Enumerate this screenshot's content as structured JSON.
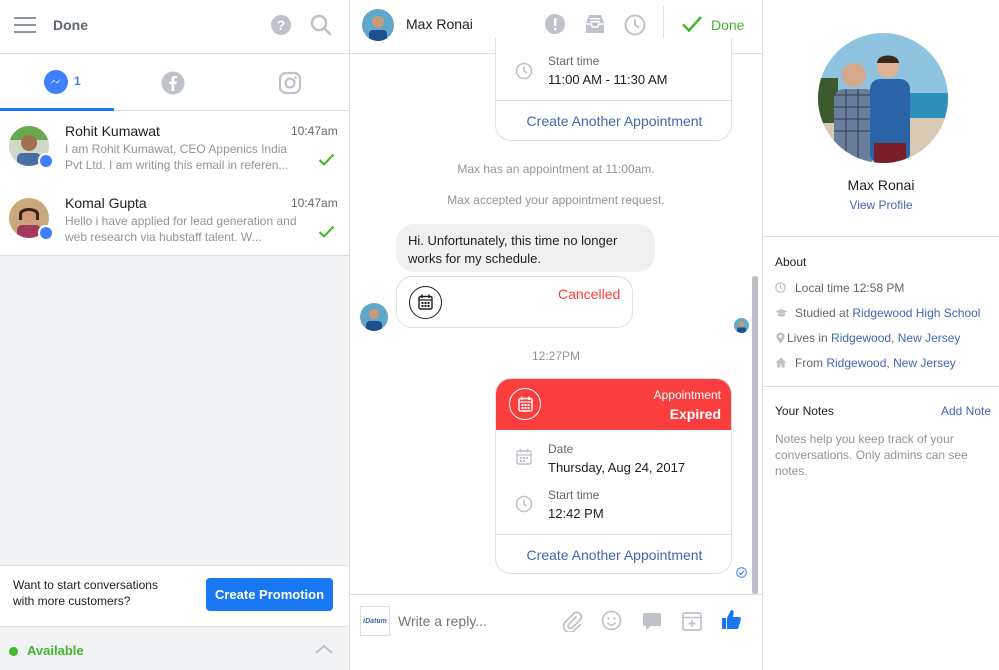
{
  "left": {
    "header": {
      "title": "Done"
    },
    "tabs": {
      "messenger_count": "1"
    },
    "conversations": [
      {
        "name": "Rohit Kumawat",
        "time": "10:47am",
        "preview": "I am Rohit Kumawat, CEO Appenics India Pvt Ltd. I am writing this email in referen..."
      },
      {
        "name": "Komal Gupta",
        "time": "10:47am",
        "preview": "Hello i have applied for lead generation and web research via hubstaff talent. W..."
      }
    ],
    "promo": {
      "text": "Want to start conversations with more customers?",
      "button": "Create Promotion"
    },
    "status": {
      "label": "Available"
    }
  },
  "chat": {
    "header": {
      "name": "Max Ronai",
      "done_label": "Done"
    },
    "top_card": {
      "start_label": "Start time",
      "start_value": "11:00 AM - 11:30 AM",
      "action": "Create Another Appointment"
    },
    "system_msgs": [
      "Max has an appointment at 11:00am.",
      "Max accepted your appointment request."
    ],
    "message": "Hi. Unfortunately, this time no longer works for my schedule.",
    "cancel_card": {
      "status": "Cancelled"
    },
    "timestamp": "12:27PM",
    "expired_card": {
      "label": "Appointment",
      "status": "Expired",
      "date_label": "Date",
      "date_value": "Thursday, Aug 24, 2017",
      "start_label": "Start time",
      "start_value": "12:42 PM",
      "action": "Create Another Appointment"
    },
    "composer": {
      "placeholder": "Write a reply...",
      "page_logo": "iDatum"
    }
  },
  "profile": {
    "name": "Max Ronai",
    "view_profile": "View Profile",
    "about_title": "About",
    "local_time": "Local time 12:58 PM",
    "studied_prefix": "Studied at ",
    "studied_school": "Ridgewood High School",
    "lives_prefix": "Lives in ",
    "lives_city": "Ridgewood",
    "lives_state": "New Jersey",
    "from_prefix": "From ",
    "from_city": "Ridgewood",
    "from_state": "New Jersey",
    "notes_title": "Your Notes",
    "add_note": "Add Note",
    "notes_help": "Notes help you keep track of your conversations. Only admins can see notes."
  },
  "colors": {
    "accent": "#1877f2",
    "messenger": "#4080ff",
    "green": "#42b72a",
    "red": "#fa3e3e",
    "link": "#4267b2"
  }
}
